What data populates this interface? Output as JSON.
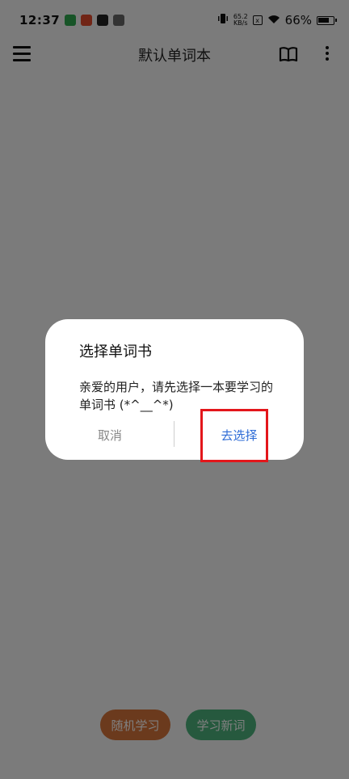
{
  "status_bar": {
    "time": "12:37",
    "net_speed_value": "65.2",
    "net_speed_unit": "KB/s",
    "battery": "66%",
    "icons": [
      "wechat-icon",
      "app-icon",
      "tiktok-icon",
      "link-icon",
      "vibrate-icon",
      "sim-icon",
      "wifi-icon",
      "battery-icon"
    ]
  },
  "toolbar": {
    "title": "默认单词本"
  },
  "bottom_buttons": {
    "random": "随机学习",
    "new_words": "学习新词"
  },
  "dialog": {
    "title": "选择单词书",
    "message": "亲爱的用户，请先选择一本要学习的单词书 (*^__^*)",
    "cancel": "取消",
    "confirm": "去选择"
  },
  "colors": {
    "random_btn": "#d7743a",
    "new_btn": "#4cb37c",
    "confirm_text": "#2d6bd6",
    "highlight": "#e3161b"
  }
}
